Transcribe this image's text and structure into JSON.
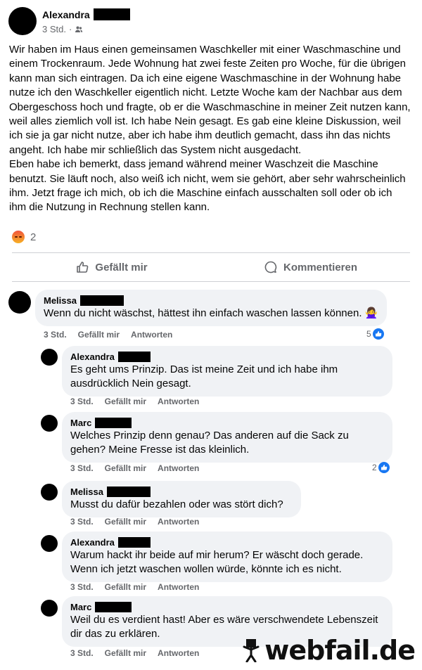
{
  "post": {
    "author": "Alexandra",
    "time": "3 Std.",
    "separator": "·",
    "audience_icon": "friends-icon",
    "text": "Wir haben im Haus einen gemeinsamen Waschkeller mit einer Waschmaschine und einem Trockenraum. Jede Wohnung hat zwei feste Zeiten pro Woche, für die übrigen kann man sich eintragen. Da ich eine eigene Waschmaschine in der Wohnung habe nutze ich den Waschkeller eigentlich nicht. Letzte Woche kam der Nachbar aus dem Obergeschoss hoch und fragte, ob er die Waschmaschine in meiner Zeit nutzen kann, weil alles ziemlich voll ist. Ich habe Nein gesagt. Es gab eine kleine Diskussion, weil ich sie ja gar nicht nutze, aber ich habe ihm deutlich gemacht, dass ihn das nichts angeht. Ich habe mir schließlich das System nicht ausgedacht.\nEben habe ich bemerkt, dass jemand während meiner Waschzeit die Maschine benutzt. Sie läuft noch, also weiß ich nicht, wem sie gehört, aber sehr wahrscheinlich ihm. Jetzt frage ich mich, ob ich die Maschine einfach ausschalten soll oder ob ich ihm die Nutzung in Rechnung stellen kann.",
    "reaction_icon": "angry-reaction-icon",
    "reaction_count": "2"
  },
  "actions": {
    "like_label": "Gefällt mir",
    "comment_label": "Kommentieren"
  },
  "comment_actions": {
    "like": "Gefällt mir",
    "reply": "Antworten"
  },
  "comments": [
    {
      "author": "Melissa",
      "text": "Wenn du nicht wäschst, hättest ihn einfach waschen lassen können. 🙅‍♀️",
      "time": "3 Std.",
      "likes": "5"
    },
    {
      "author": "Alexandra",
      "text": "Es geht ums Prinzip. Das ist meine Zeit und ich habe ihm\nausdrücklich Nein gesagt.",
      "time": "3 Std.",
      "likes": ""
    },
    {
      "author": "Marc",
      "text": "Welches Prinzip denn genau? Das anderen auf die Sack zu\ngehen? Meine Fresse ist das kleinlich.",
      "time": "3 Std.",
      "likes": "2"
    },
    {
      "author": "Melissa",
      "text": "Musst du dafür bezahlen oder was stört dich?",
      "time": "3 Std.",
      "likes": ""
    },
    {
      "author": "Alexandra",
      "text": "Warum hackt ihr beide auf mir herum? Er wäscht doch gerade.\nWenn ich jetzt waschen wollen würde, könnte ich es nicht.",
      "time": "3 Std.",
      "likes": ""
    },
    {
      "author": "Marc",
      "text": "Weil du es verdient hast! Aber es wäre verschwendete Lebenszeit\ndir das zu erklären.",
      "time": "3 Std.",
      "likes": ""
    }
  ],
  "watermark": {
    "text": "webfail.de",
    "icon": "webfail-mascot-icon"
  }
}
